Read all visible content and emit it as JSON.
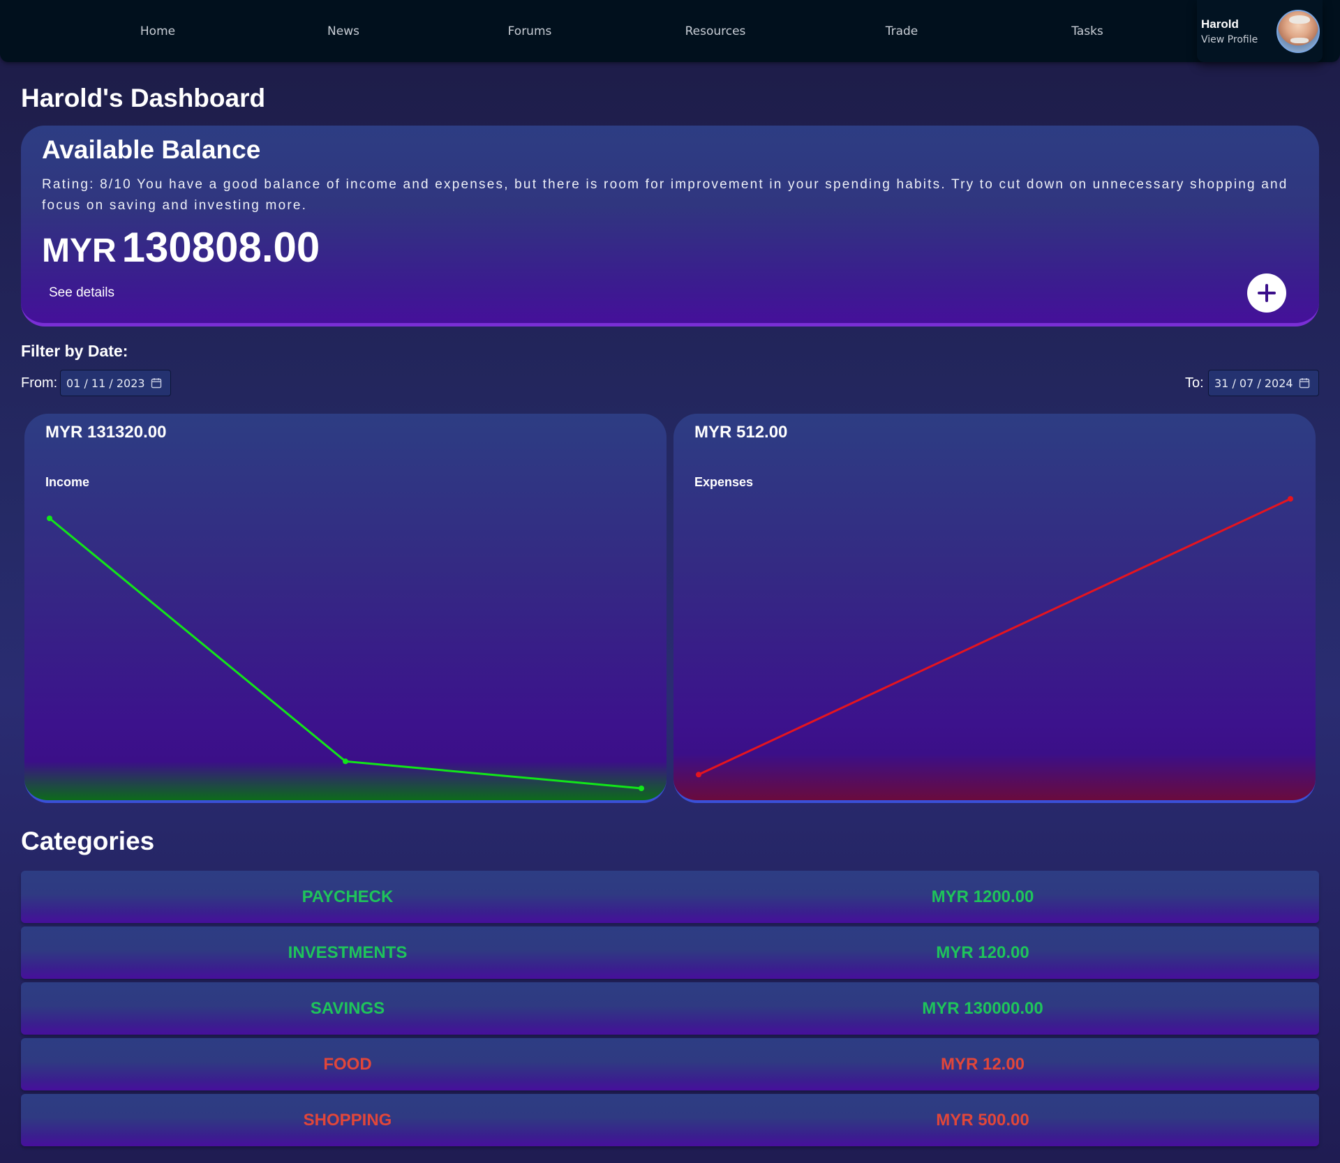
{
  "nav": {
    "items": [
      {
        "label": "Home"
      },
      {
        "label": "News"
      },
      {
        "label": "Forums"
      },
      {
        "label": "Resources"
      },
      {
        "label": "Trade"
      },
      {
        "label": "Tasks"
      }
    ],
    "profile": {
      "name": "Harold",
      "link": "View Profile"
    }
  },
  "page": {
    "title": "Harold's Dashboard"
  },
  "balance": {
    "title": "Available Balance",
    "rating": "Rating: 8/10 You have a good balance of income and expenses, but there is room for improvement in your spending habits. Try to cut down on unnecessary shopping and focus on saving and investing more.",
    "currency": "MYR",
    "amount": "130808.00",
    "details_link": "See details",
    "add_icon": "plus-icon"
  },
  "filter": {
    "title": "Filter by Date:",
    "from_label": "From:",
    "from_value": "01 / 11 / 2023",
    "to_label": "To:",
    "to_value": "31 / 07 / 2024",
    "calendar_icon": "calendar-icon"
  },
  "income": {
    "amount": "MYR 131320.00",
    "label": "Income",
    "color": "#12e619"
  },
  "expenses": {
    "amount": "MYR 512.00",
    "label": "Expenses",
    "color": "#e5141f"
  },
  "chart_data": [
    {
      "type": "line",
      "title": "Income",
      "series": [
        {
          "values": [
            1200,
            120,
            0
          ]
        }
      ],
      "x": [
        0,
        1,
        2
      ],
      "ylim": [
        0,
        1200
      ],
      "grid": false,
      "color": "#12e619"
    },
    {
      "type": "line",
      "title": "Expenses",
      "series": [
        {
          "values": [
            12,
            500
          ]
        }
      ],
      "x": [
        0,
        1
      ],
      "ylim": [
        0,
        500
      ],
      "grid": false,
      "color": "#e5141f"
    }
  ],
  "categories": {
    "title": "Categories",
    "income_color": "#1fc45b",
    "expense_color": "#e1463a",
    "items": [
      {
        "name": "PAYCHECK",
        "amount": "MYR 1200.00",
        "kind": "income"
      },
      {
        "name": "INVESTMENTS",
        "amount": "MYR 120.00",
        "kind": "income"
      },
      {
        "name": "SAVINGS",
        "amount": "MYR 130000.00",
        "kind": "income"
      },
      {
        "name": "FOOD",
        "amount": "MYR 12.00",
        "kind": "expense"
      },
      {
        "name": "SHOPPING",
        "amount": "MYR 500.00",
        "kind": "expense"
      }
    ]
  }
}
